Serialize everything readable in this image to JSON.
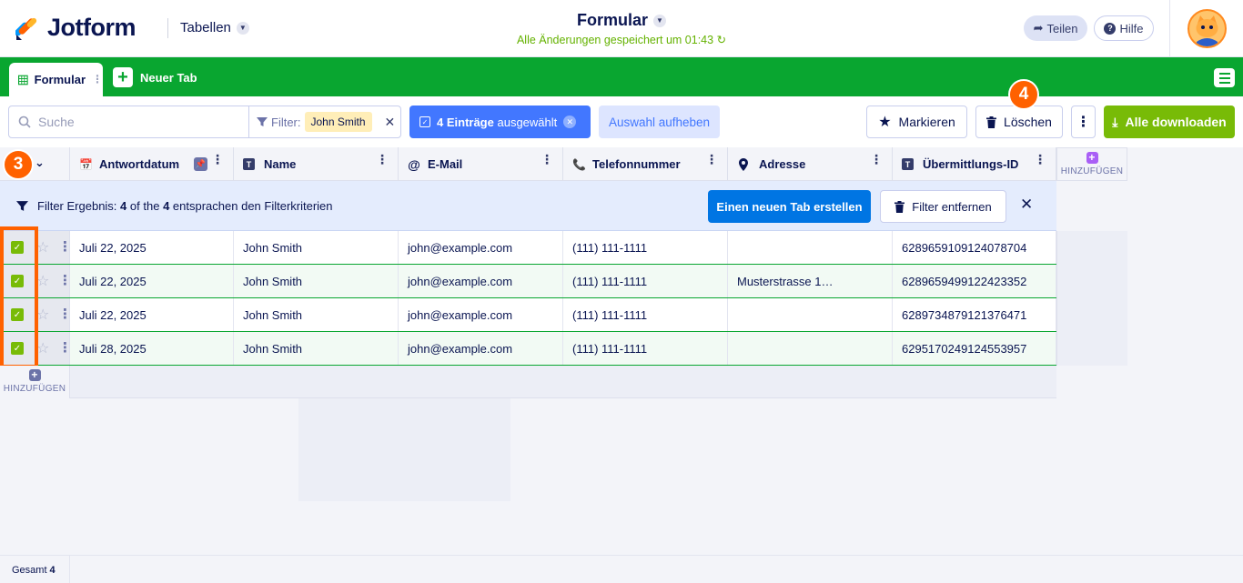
{
  "header": {
    "brand": "Jotform",
    "section": "Tabellen",
    "title": "Formular",
    "saved_status": "Alle Änderungen gespeichert um 01:43",
    "share_label": "Teilen",
    "help_label": "Hilfe"
  },
  "tabs": {
    "active": "Formular",
    "new_tab": "Neuer Tab"
  },
  "toolbar": {
    "search_placeholder": "Suche",
    "filter_label": "Filter:",
    "filter_chip": "John Smith",
    "selected_count": "4 Einträge",
    "selected_suffix": "ausgewählt",
    "clear_selection": "Auswahl aufheben",
    "mark_label": "Markieren",
    "delete_label": "Löschen",
    "download_label": "Alle downloaden"
  },
  "badges": {
    "step3": "3",
    "step4": "4"
  },
  "columns": [
    {
      "label": "Antwortdatum"
    },
    {
      "label": "Name"
    },
    {
      "label": "E-Mail"
    },
    {
      "label": "Telefonnummer"
    },
    {
      "label": "Adresse"
    },
    {
      "label": "Übermittlungs-ID"
    }
  ],
  "add_column": "HINZUFÜGEN",
  "banner": {
    "prefix": "Filter Ergebnis:",
    "count": "4",
    "of_the": "of the",
    "total": "4",
    "suffix": "entsprachen den Filterkriterien",
    "new_tab_button": "Einen neuen Tab erstellen",
    "remove_filter": "Filter entfernen"
  },
  "rows": [
    {
      "date": "Juli 22, 2025",
      "name": "John Smith",
      "email": "john@example.com",
      "phone": "(111) 111-1111",
      "address": "",
      "id": "6289659109124078704"
    },
    {
      "date": "Juli 22, 2025",
      "name": "John Smith",
      "email": "john@example.com",
      "phone": "(111) 111-1111",
      "address": "Musterstrasse 1…",
      "id": "6289659499122423352"
    },
    {
      "date": "Juli 22, 2025",
      "name": "John Smith",
      "email": "john@example.com",
      "phone": "(111) 111-1111",
      "address": "",
      "id": "6289734879121376471"
    },
    {
      "date": "Juli 28, 2025",
      "name": "John Smith",
      "email": "john@example.com",
      "phone": "(111) 111-1111",
      "address": "",
      "id": "6295170249124553957"
    }
  ],
  "add_row": "HINZUFÜGEN",
  "footer": {
    "total_label": "Gesamt",
    "total_value": "4"
  },
  "colors": {
    "brand_green": "#09a630",
    "accent_blue": "#4277ff",
    "download_green": "#78bb07",
    "highlight_orange": "#ff6100"
  }
}
